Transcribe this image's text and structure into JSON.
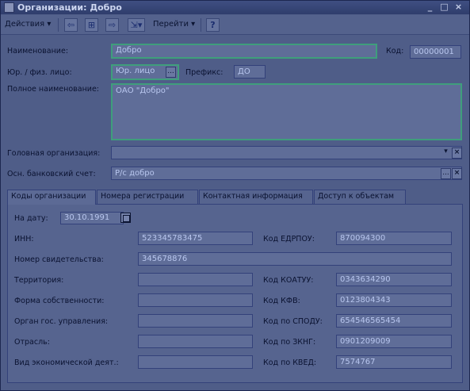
{
  "window": {
    "title": "Организации: Добро",
    "controls": {
      "minimize": "_",
      "maximize": "□",
      "close": "×"
    }
  },
  "toolbar": {
    "actions_label": "Действия",
    "goto_label": "Перейти",
    "help_label": "?",
    "icons": [
      "arrow-back-icon",
      "structure-icon",
      "go-icon",
      "help-icon"
    ]
  },
  "form": {
    "name": {
      "label": "Наименование:",
      "value": "Добро"
    },
    "code": {
      "label": "Код:",
      "value": "00000001"
    },
    "person_type": {
      "label": "Юр. / физ. лицо:",
      "value": "Юр. лицо",
      "button": "..."
    },
    "prefix": {
      "label": "Префикс:",
      "value": "ДО"
    },
    "full_name": {
      "label": "Полное наименование:",
      "value": "ОАО \"Добро\""
    },
    "head_org": {
      "label": "Головная организация:",
      "value": ""
    },
    "bank_account": {
      "label": "Осн. банковский счет:",
      "value": "Р/с добро",
      "button": "..."
    }
  },
  "tabs": [
    {
      "label": "Коды организации"
    },
    {
      "label": "Номера регистрации"
    },
    {
      "label": "Контактная информация"
    },
    {
      "label": "Доступ к объектам"
    }
  ],
  "codes": {
    "date": {
      "label": "На дату:",
      "value": "30.10.1991"
    },
    "inn": {
      "label": "ИНН:",
      "value": "523345783475"
    },
    "edrpou": {
      "label": "Код ЕДРПОУ:",
      "value": "870094300"
    },
    "certificate": {
      "label": "Номер свидетельства:",
      "value": "345678876"
    },
    "territory": {
      "label": "Территория:",
      "value": ""
    },
    "koatuu": {
      "label": "Код КОАТУУ:",
      "value": "0343634290"
    },
    "ownership": {
      "label": "Форма собственности:",
      "value": ""
    },
    "kfv": {
      "label": "Код КФВ:",
      "value": "0123804343"
    },
    "gov_body": {
      "label": "Орган гос. управления:",
      "value": ""
    },
    "spodu": {
      "label": "Код по СПОДУ:",
      "value": "654546565454"
    },
    "industry": {
      "label": "Отрасль:",
      "value": ""
    },
    "zkng": {
      "label": "Код по ЗКНГ:",
      "value": "0901209009"
    },
    "activity": {
      "label": "Вид экономической деят.:",
      "value": ""
    },
    "kved": {
      "label": "Код по КВЕД:",
      "value": "7574767"
    }
  }
}
